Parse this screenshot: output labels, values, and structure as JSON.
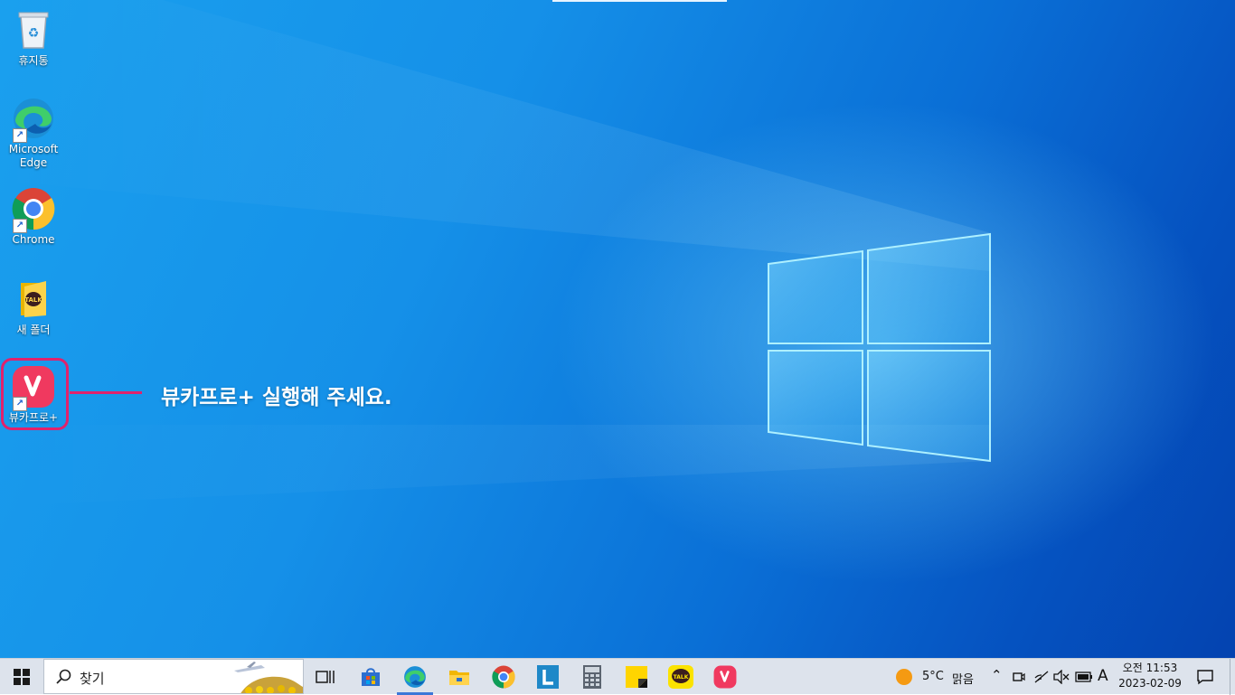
{
  "desktop": {
    "icons": [
      {
        "label": "휴지통",
        "icon": "recycle-bin-icon"
      },
      {
        "label": "Microsoft Edge",
        "icon": "edge-icon"
      },
      {
        "label": "Chrome",
        "icon": "chrome-icon"
      },
      {
        "label": "새 폴더",
        "icon": "folder-icon"
      },
      {
        "label": "뷰카프로+",
        "icon": "vcapro-icon"
      }
    ],
    "callout": "뷰카프로+ 실행해 주세요.",
    "highlight_color": "#e0226c"
  },
  "taskbar": {
    "search_placeholder": "찾기",
    "pinned_apps": [
      {
        "name": "task-view",
        "icon": "task-view-icon"
      },
      {
        "name": "microsoft-store",
        "icon": "store-icon"
      },
      {
        "name": "edge",
        "icon": "edge-icon"
      },
      {
        "name": "file-explorer",
        "icon": "folder-icon"
      },
      {
        "name": "chrome",
        "icon": "chrome-icon"
      },
      {
        "name": "l-app",
        "icon": "l-app-icon"
      },
      {
        "name": "calculator",
        "icon": "calculator-icon"
      },
      {
        "name": "sticky-notes",
        "icon": "sticky-notes-icon"
      },
      {
        "name": "kakaotalk",
        "icon": "kakaotalk-icon"
      },
      {
        "name": "vcapro",
        "icon": "vcapro-icon"
      }
    ],
    "weather": {
      "temp": "5°C",
      "condition": "맑음"
    },
    "ime": "A",
    "clock": {
      "time": "오전 11:53",
      "date": "2023-02-09"
    }
  }
}
